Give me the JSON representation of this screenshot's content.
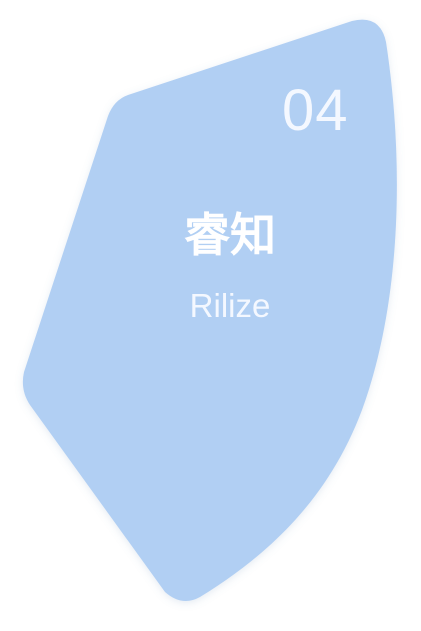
{
  "card": {
    "number": "04",
    "title": "睿知",
    "subtitle": "Rilize",
    "colors": {
      "fill": "#b1cff3",
      "text": "#ffffff",
      "background": "#ffffff"
    }
  }
}
